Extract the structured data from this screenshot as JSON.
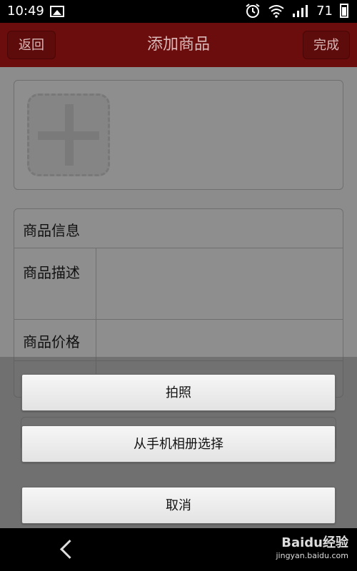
{
  "status_bar": {
    "time": "10:49",
    "battery": "71",
    "icons": [
      "image-icon",
      "alarm-icon",
      "wifi-icon",
      "signal-icon",
      "battery-icon"
    ]
  },
  "top_bar": {
    "title": "添加商品",
    "back_label": "返回",
    "done_label": "完成",
    "color": "#6b0d0d"
  },
  "photo_section": {
    "add_icon": "plus-icon"
  },
  "info_section": {
    "header": "商品信息",
    "description_label": "商品描述",
    "price_label": "商品价格"
  },
  "action_sheet": {
    "take_photo_label": "拍照",
    "choose_album_label": "从手机相册选择",
    "cancel_label": "取消"
  },
  "nav_bar": {
    "back_icon": "chevron-left-icon"
  },
  "watermark": {
    "brand": "Baidu经验",
    "url": "jingyan.baidu.com"
  }
}
